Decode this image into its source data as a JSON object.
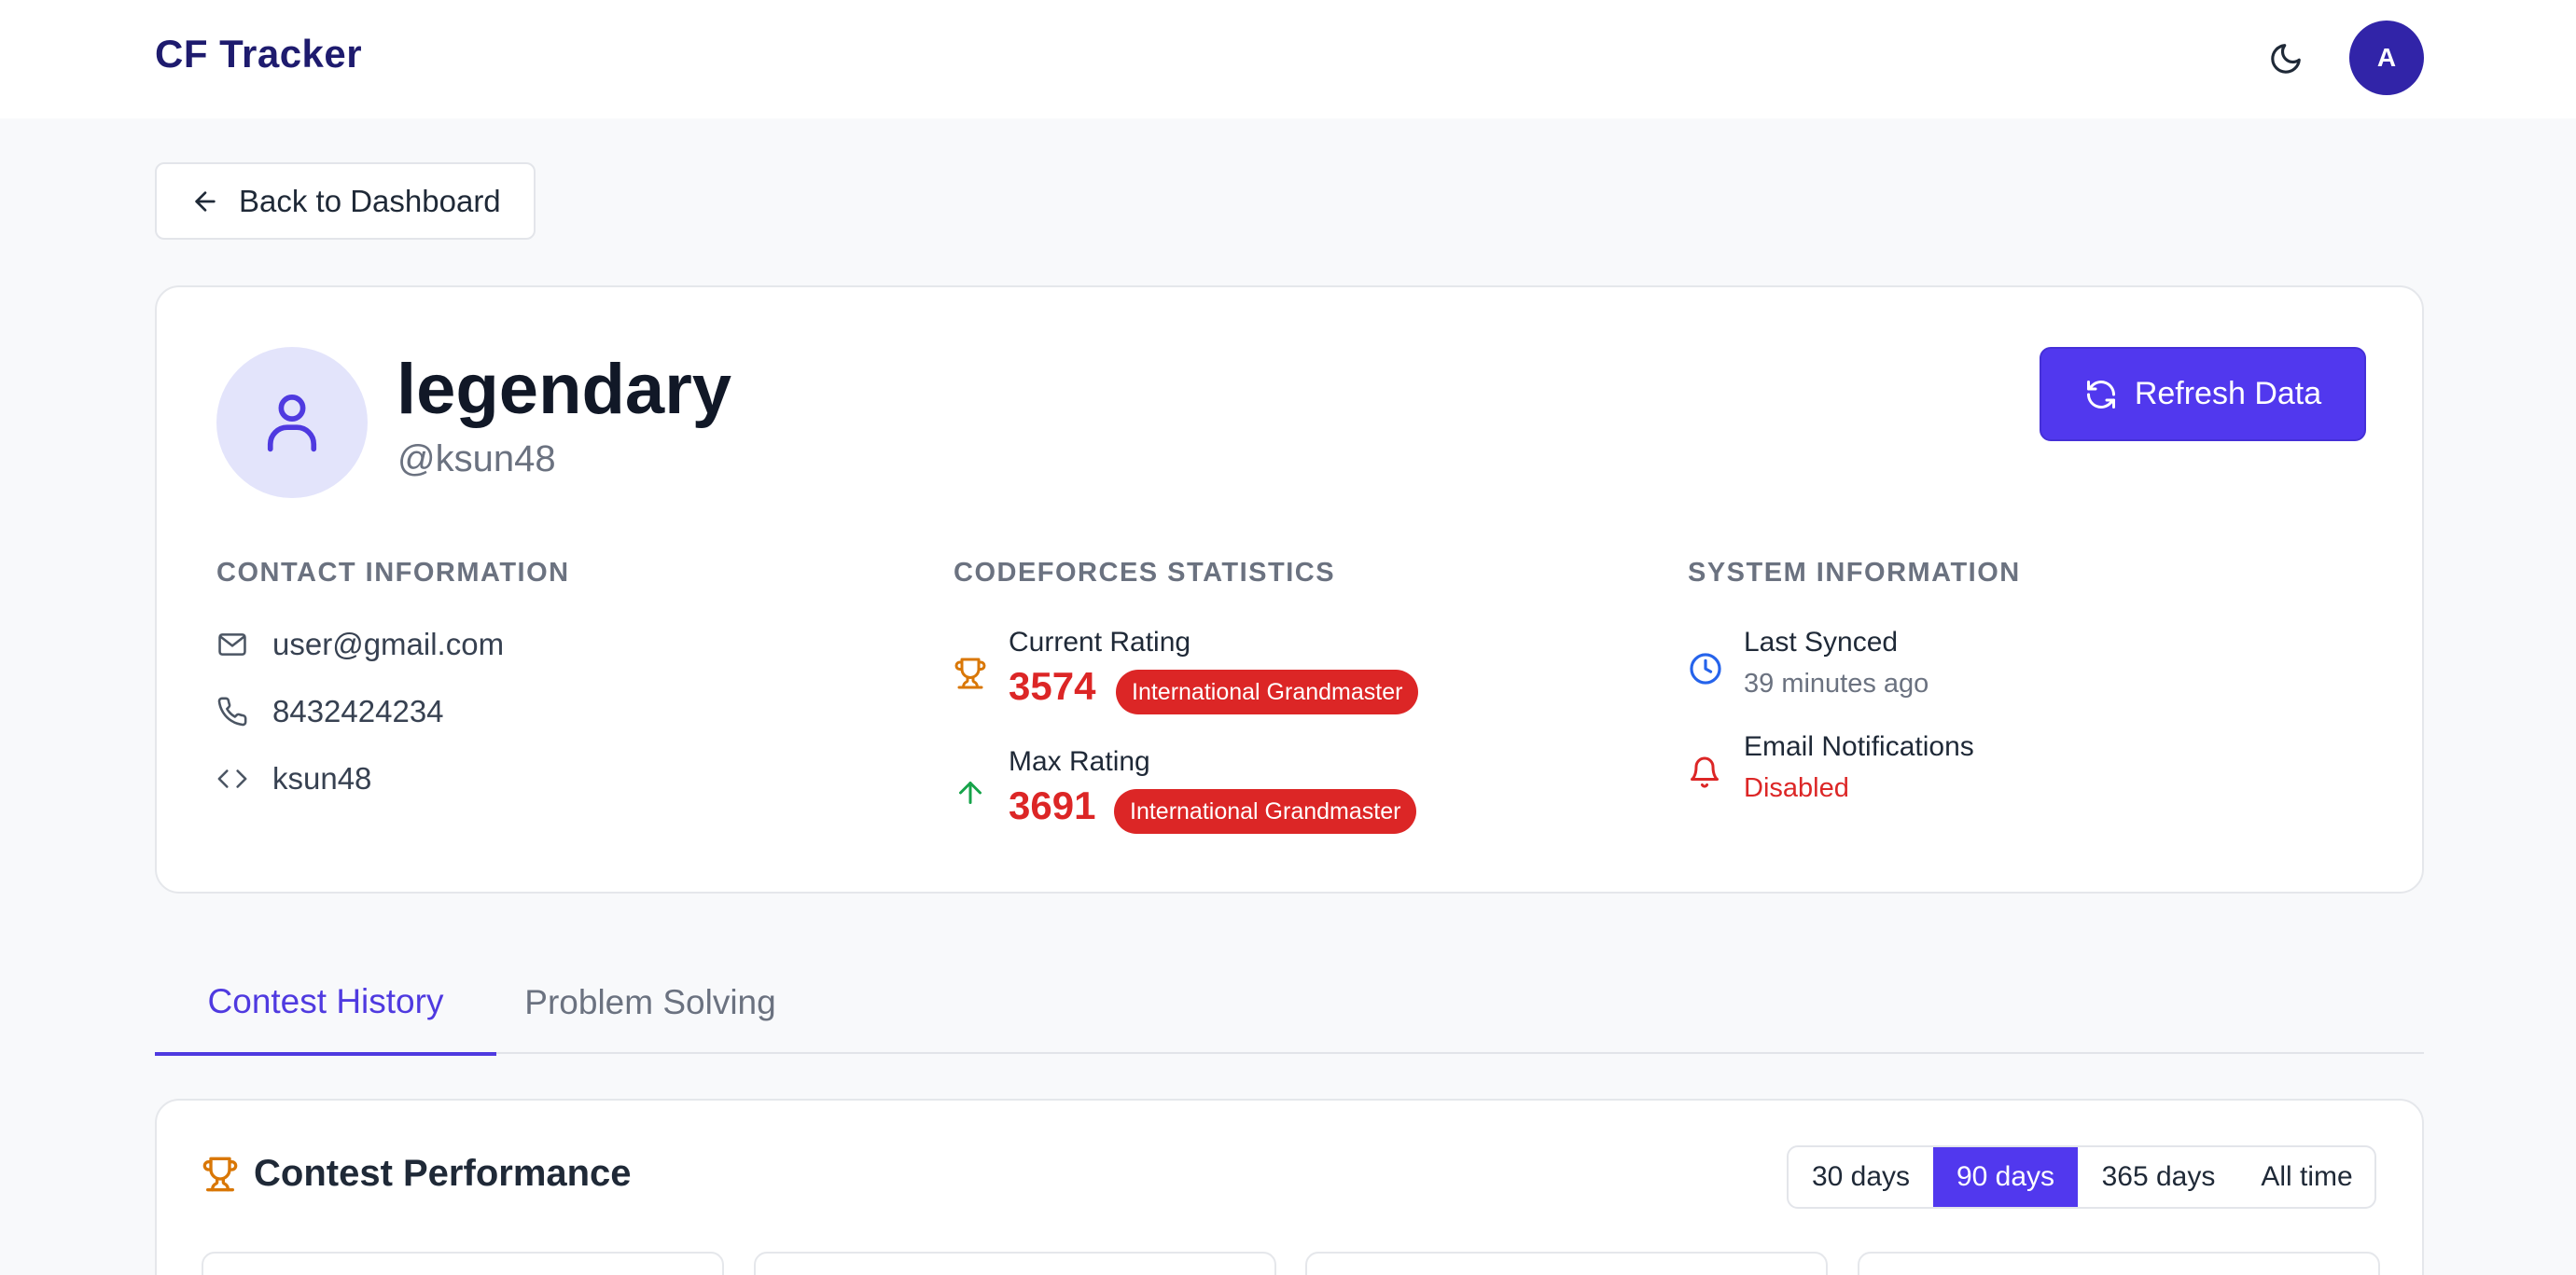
{
  "header": {
    "brand": "CF Tracker",
    "avatar_initial": "A",
    "theme_icon": "moon-icon"
  },
  "back_button": {
    "label": "Back to Dashboard",
    "icon": "arrow-left-icon"
  },
  "profile": {
    "name": "legendary",
    "handle": "@ksun48",
    "refresh_label": "Refresh Data",
    "contact": {
      "heading": "CONTACT INFORMATION",
      "email": "user@gmail.com",
      "phone": "8432424234",
      "cf_handle": "ksun48"
    },
    "stats": {
      "heading": "CODEFORCES STATISTICS",
      "current_label": "Current Rating",
      "current_value": "3574",
      "current_rank": "International Grandmaster",
      "max_label": "Max Rating",
      "max_value": "3691",
      "max_rank": "International Grandmaster"
    },
    "system": {
      "heading": "SYSTEM INFORMATION",
      "synced_label": "Last Synced",
      "synced_value": "39 minutes ago",
      "notif_label": "Email Notifications",
      "notif_value": "Disabled"
    }
  },
  "tabs": [
    {
      "label": "Contest History",
      "active": true
    },
    {
      "label": "Problem Solving",
      "active": false
    }
  ],
  "performance": {
    "title": "Contest Performance",
    "ranges": [
      {
        "label": "30 days",
        "active": false
      },
      {
        "label": "90 days",
        "active": true
      },
      {
        "label": "365 days",
        "active": false
      },
      {
        "label": "All time",
        "active": false
      }
    ]
  },
  "colors": {
    "accent": "#5138ee",
    "brand": "#1e1b6e",
    "danger": "#dc2626",
    "trophy": "#d97706",
    "up": "#16a34a",
    "clock": "#2563eb"
  }
}
